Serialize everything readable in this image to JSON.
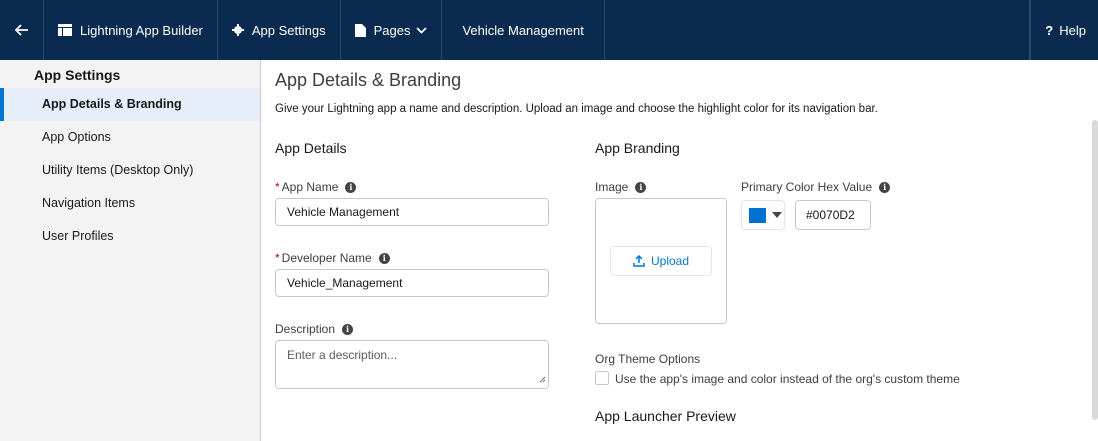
{
  "topbar": {
    "app_builder": "Lightning App Builder",
    "app_settings": "App Settings",
    "pages": "Pages",
    "app_name": "Vehicle Management",
    "help": "Help"
  },
  "sidebar": {
    "title": "App Settings",
    "items": [
      {
        "label": "App Details & Branding"
      },
      {
        "label": "App Options"
      },
      {
        "label": "Utility Items (Desktop Only)"
      },
      {
        "label": "Navigation Items"
      },
      {
        "label": "User Profiles"
      }
    ]
  },
  "main": {
    "title": "App Details & Branding",
    "description": "Give your Lightning app a name and description. Upload an image and choose the highlight color for its navigation bar.",
    "details": {
      "heading": "App Details",
      "app_name_label": "App Name",
      "app_name_value": "Vehicle Management",
      "developer_name_label": "Developer Name",
      "developer_name_value": "Vehicle_Management",
      "description_label": "Description",
      "description_placeholder": "Enter a description..."
    },
    "branding": {
      "heading": "App Branding",
      "image_label": "Image",
      "upload_label": "Upload",
      "color_label": "Primary Color Hex Value",
      "color_value": "#0070D2",
      "swatch_color": "#0070d2",
      "org_theme_label": "Org Theme Options",
      "org_theme_checkbox_label": "Use the app's image and color instead of the org's custom theme",
      "launcher_preview_heading": "App Launcher Preview"
    }
  }
}
